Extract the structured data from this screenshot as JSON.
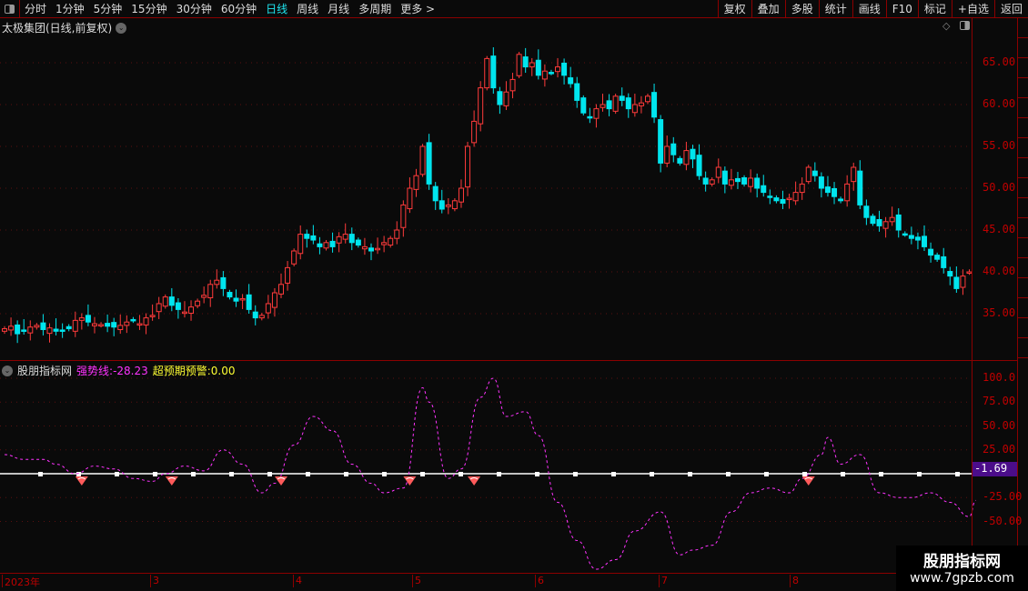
{
  "toolbar": {
    "periods": [
      "分时",
      "1分钟",
      "5分钟",
      "15分钟",
      "30分钟",
      "60分钟",
      "日线",
      "周线",
      "月线",
      "多周期",
      "更多 >"
    ],
    "active": "日线",
    "buttons": [
      "复权",
      "叠加",
      "多股",
      "统计",
      "画线",
      "F10",
      "标记",
      "+自选",
      "返回"
    ]
  },
  "main": {
    "title": "太极集团(日线,前复权)"
  },
  "indicator": {
    "name": "股朋指标网",
    "line1_label": "强势线:",
    "line1_value": "-28.23",
    "line2_label": "超预期预警:",
    "line2_value": "0.00",
    "current_value": "-1.69"
  },
  "price_axis": [
    "65.00",
    "60.00",
    "55.00",
    "50.00",
    "45.00",
    "40.00",
    "35.00"
  ],
  "ind_axis": [
    "100.0",
    "75.00",
    "50.00",
    "25.00",
    "-25.00",
    "-50.00"
  ],
  "time_axis": [
    "2023年",
    "3",
    "4",
    "5",
    "6",
    "7",
    "8"
  ],
  "watermark": {
    "line1": "股朋指标网",
    "line2": "www.7gpzb.com"
  },
  "colors": {
    "up": "#ff3b3b",
    "down": "#00e5ee",
    "line": "#ff33ff",
    "zero": "#ffffff"
  },
  "chart_data": [
    {
      "type": "candlestick",
      "title": "太极集团(日线,前复权)",
      "ylim": [
        31,
        69
      ],
      "closes": [
        33.2,
        33.5,
        32.6,
        33.0,
        33.4,
        33.6,
        33.1,
        33.3,
        32.9,
        33.0,
        33.2,
        34.2,
        34.5,
        34.0,
        33.8,
        33.7,
        33.5,
        33.4,
        33.6,
        34.0,
        34.2,
        33.8,
        34.5,
        34.8,
        36.2,
        37.0,
        36.0,
        35.5,
        35.2,
        35.8,
        36.5,
        37.2,
        38.5,
        39.0,
        38.0,
        37.0,
        36.5,
        36.8,
        35.5,
        34.5,
        34.8,
        36.2,
        37.5,
        38.5,
        40.5,
        42.5,
        44.5,
        44.0,
        43.8,
        43.0,
        43.5,
        43.0,
        44.2,
        44.5,
        43.5,
        43.2,
        43.0,
        42.5,
        42.8,
        43.5,
        44.0,
        45.0,
        48.0,
        50.0,
        51.5,
        55.0,
        50.5,
        48.5,
        47.5,
        48.0,
        48.5,
        50.0,
        55.0,
        58.0,
        62.0,
        65.5,
        62.0,
        60.0,
        61.5,
        63.0,
        66.0,
        64.5,
        65.0,
        63.5,
        64.0,
        63.8,
        64.5,
        63.5,
        62.5,
        60.5,
        59.0,
        58.5,
        59.5,
        60.0,
        59.5,
        61.0,
        60.5,
        59.5,
        60.0,
        60.2,
        61.0,
        58.5,
        53.0,
        55.0,
        54.0,
        53.0,
        54.5,
        53.5,
        51.5,
        50.5,
        51.0,
        52.5,
        50.5,
        51.0,
        50.8,
        50.5,
        51.2,
        50.0,
        49.5,
        49.0,
        48.5,
        48.2,
        48.8,
        49.5,
        50.5,
        52.5,
        51.5,
        50.0,
        49.5,
        49.0,
        48.5,
        50.5,
        52.5,
        48.0,
        46.5,
        45.8,
        45.5,
        46.0,
        46.5,
        45.0,
        44.5,
        44.0,
        43.8,
        43.0,
        42.0,
        41.5,
        40.5,
        39.5,
        38.0,
        39.5,
        40.0
      ]
    },
    {
      "type": "line",
      "name": "强势线",
      "ylim": [
        -105,
        110
      ],
      "points": [
        [
          0,
          20
        ],
        [
          3,
          15
        ],
        [
          6,
          15
        ],
        [
          8,
          10
        ],
        [
          11,
          0
        ],
        [
          14,
          8
        ],
        [
          17,
          5
        ],
        [
          20,
          -5
        ],
        [
          23,
          -8
        ],
        [
          25,
          0
        ],
        [
          28,
          8
        ],
        [
          31,
          3
        ],
        [
          34,
          25
        ],
        [
          37,
          10
        ],
        [
          40,
          -20
        ],
        [
          42,
          -10
        ],
        [
          45,
          30
        ],
        [
          48,
          60
        ],
        [
          51,
          45
        ],
        [
          54,
          10
        ],
        [
          57,
          -10
        ],
        [
          59,
          -20
        ],
        [
          62,
          -15
        ],
        [
          65,
          90
        ],
        [
          66,
          75
        ],
        [
          69,
          -5
        ],
        [
          71,
          5
        ],
        [
          74,
          80
        ],
        [
          76,
          100
        ],
        [
          78,
          60
        ],
        [
          81,
          65
        ],
        [
          83,
          40
        ],
        [
          86,
          -30
        ],
        [
          89,
          -70
        ],
        [
          92,
          -100
        ],
        [
          95,
          -90
        ],
        [
          98,
          -60
        ],
        [
          102,
          -40
        ],
        [
          105,
          -85
        ],
        [
          107,
          -80
        ],
        [
          110,
          -75
        ],
        [
          113,
          -40
        ],
        [
          116,
          -20
        ],
        [
          119,
          -15
        ],
        [
          122,
          -20
        ],
        [
          124,
          -5
        ],
        [
          127,
          20
        ],
        [
          128,
          38
        ],
        [
          130,
          10
        ],
        [
          133,
          20
        ],
        [
          136,
          -20
        ],
        [
          139,
          -25
        ],
        [
          141,
          -25
        ],
        [
          144,
          -20
        ],
        [
          147,
          -30
        ],
        [
          150,
          -45
        ],
        [
          151,
          -28
        ]
      ],
      "zero_markers_every": 6,
      "alerts": [
        12,
        26,
        43,
        63,
        73,
        125
      ]
    }
  ]
}
